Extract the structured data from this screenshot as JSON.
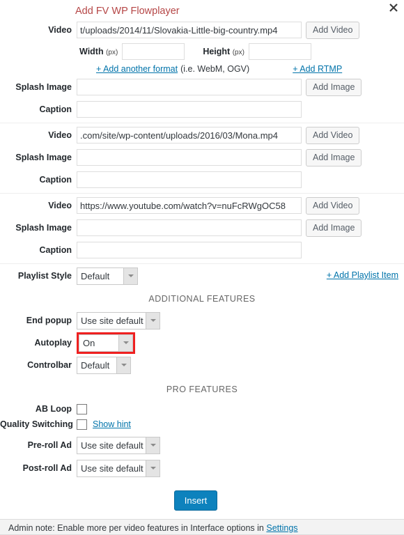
{
  "header": {
    "title": "Add FV WP Flowplayer",
    "close_icon": "close-icon"
  },
  "items": [
    {
      "video_label": "Video",
      "video_value": "t/uploads/2014/11/Slovakia-Little-big-country.mp4",
      "add_video_label": "Add Video",
      "width_label": "Width",
      "width_unit": "(px)",
      "width_value": "",
      "height_label": "Height",
      "height_unit": "(px)",
      "height_value": "",
      "add_format_link": "+ Add another format",
      "add_format_note": "(i.e. WebM, OGV)",
      "add_rtmp_link": "+ Add RTMP",
      "splash_label": "Splash Image",
      "splash_value": "",
      "add_image_label": "Add Image",
      "caption_label": "Caption",
      "caption_value": ""
    },
    {
      "video_label": "Video",
      "video_value": ".com/site/wp-content/uploads/2016/03/Mona.mp4",
      "add_video_label": "Add Video",
      "splash_label": "Splash Image",
      "splash_value": "",
      "add_image_label": "Add Image",
      "caption_label": "Caption",
      "caption_value": ""
    },
    {
      "video_label": "Video",
      "video_value": "https://www.youtube.com/watch?v=nuFcRWgOC58",
      "add_video_label": "Add Video",
      "splash_label": "Splash Image",
      "splash_value": "",
      "add_image_label": "Add Image",
      "caption_label": "Caption",
      "caption_value": ""
    }
  ],
  "playlist": {
    "label": "Playlist Style",
    "value": "Default",
    "add_item_link": "+ Add Playlist Item"
  },
  "additional_features": {
    "heading": "ADDITIONAL FEATURES",
    "end_popup_label": "End popup",
    "end_popup_value": "Use site default",
    "autoplay_label": "Autoplay",
    "autoplay_value": "On",
    "autoplay_highlight_color": "#ef2020",
    "controlbar_label": "Controlbar",
    "controlbar_value": "Default"
  },
  "pro_features": {
    "heading": "PRO FEATURES",
    "ab_loop_label": "AB Loop",
    "ab_loop_checked": false,
    "quality_switching_label": "Quality Switching",
    "quality_switching_checked": false,
    "show_hint_link": "Show hint",
    "preroll_label": "Pre-roll Ad",
    "preroll_value": "Use site default",
    "postroll_label": "Post-roll Ad",
    "postroll_value": "Use site default"
  },
  "footer": {
    "insert_label": "Insert",
    "admin_note_prefix": "Admin note: Enable more per video features in Interface options in",
    "admin_note_link": "Settings"
  },
  "colors": {
    "title": "#b54646",
    "link": "#0073aa",
    "insert_button": "#0d82bd",
    "highlight": "#ef2020"
  }
}
